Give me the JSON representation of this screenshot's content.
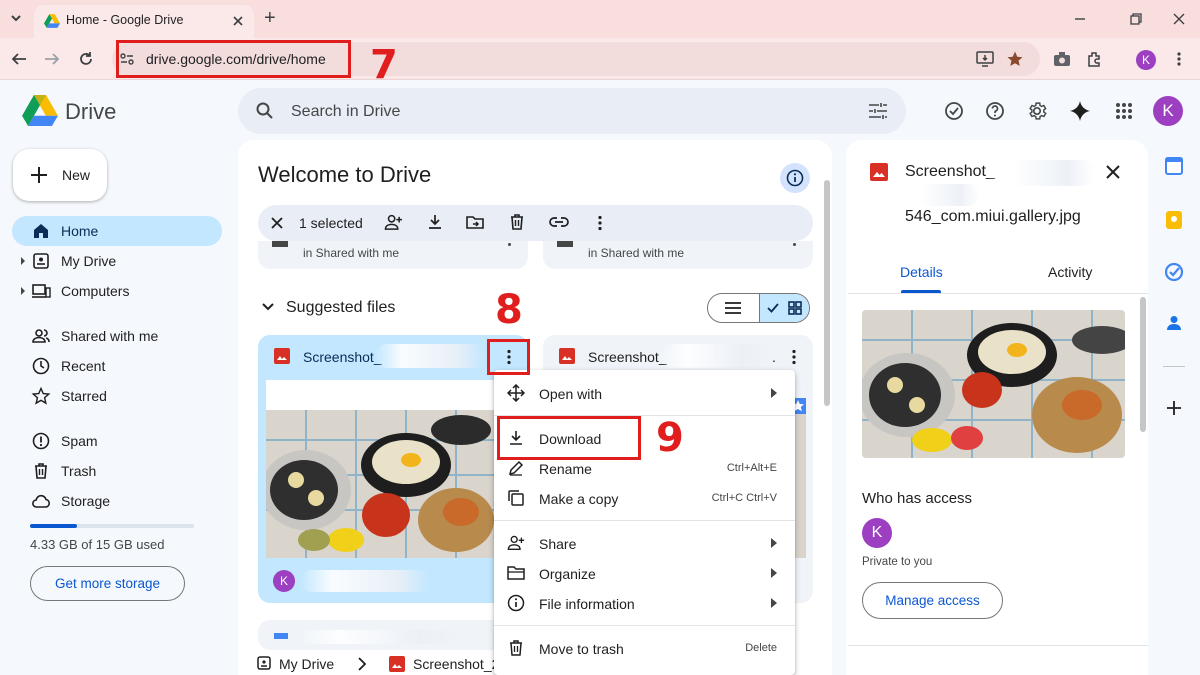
{
  "browser": {
    "tab_title": "Home - Google Drive",
    "new_tab": "+",
    "url": "drive.google.com/drive/home",
    "profile_initial": "K"
  },
  "drive": {
    "product_name": "Drive",
    "search_placeholder": "Search in Drive",
    "avatar_initial": "K",
    "new_button": "New",
    "nav": [
      {
        "label": "Home",
        "icon": "home-icon"
      },
      {
        "label": "My Drive",
        "icon": "my-drive-icon"
      },
      {
        "label": "Computers",
        "icon": "computers-icon"
      },
      {
        "label": "Shared with me",
        "icon": "shared-icon"
      },
      {
        "label": "Recent",
        "icon": "clock-icon"
      },
      {
        "label": "Starred",
        "icon": "star-icon"
      },
      {
        "label": "Spam",
        "icon": "spam-icon"
      },
      {
        "label": "Trash",
        "icon": "trash-icon"
      },
      {
        "label": "Storage",
        "icon": "cloud-icon"
      }
    ],
    "storage": {
      "text": "4.33 GB of 15 GB used",
      "fraction": 0.289,
      "get_more": "Get more storage"
    },
    "main": {
      "title": "Welcome to Drive",
      "selection_count": "1 selected",
      "top_card_left_sub": "in Shared with me",
      "top_card_right_sub": "in Shared with me",
      "suggested_label": "Suggested files",
      "card1_name": "Screenshot_",
      "card2_name": "Screenshot_",
      "card2_trail": ".",
      "owner_initial": "K",
      "breadcrumb_root": "My Drive",
      "breadcrumb_file": "Screenshot_2"
    },
    "context_menu": [
      {
        "label": "Open with",
        "shortcut": "",
        "submenu": true
      },
      {
        "label": "Download",
        "shortcut": "",
        "submenu": false
      },
      {
        "label": "Rename",
        "shortcut": "Ctrl+Alt+E",
        "submenu": false
      },
      {
        "label": "Make a copy",
        "shortcut": "Ctrl+C Ctrl+V",
        "submenu": false
      },
      {
        "label": "Share",
        "shortcut": "",
        "submenu": true
      },
      {
        "label": "Organize",
        "shortcut": "",
        "submenu": true
      },
      {
        "label": "File information",
        "shortcut": "",
        "submenu": true
      },
      {
        "label": "Move to trash",
        "shortcut": "Delete",
        "submenu": false
      }
    ],
    "details": {
      "file_name_line1": "Screenshot_",
      "file_name_line2": "546_com.miui.gallery.jpg",
      "tab_details": "Details",
      "tab_activity": "Activity",
      "who_has_access": "Who has access",
      "access_initial": "K",
      "private_text": "Private to you",
      "manage_access": "Manage access"
    }
  },
  "annotations": {
    "step_address": "7",
    "step_more": "8",
    "step_download": "9"
  },
  "colors": {
    "accent_blue": "#0b57d0",
    "selected_nav": "#c2e7ff",
    "annotation_red": "#e01e1e",
    "avatar_purple": "#9c3fc1"
  }
}
